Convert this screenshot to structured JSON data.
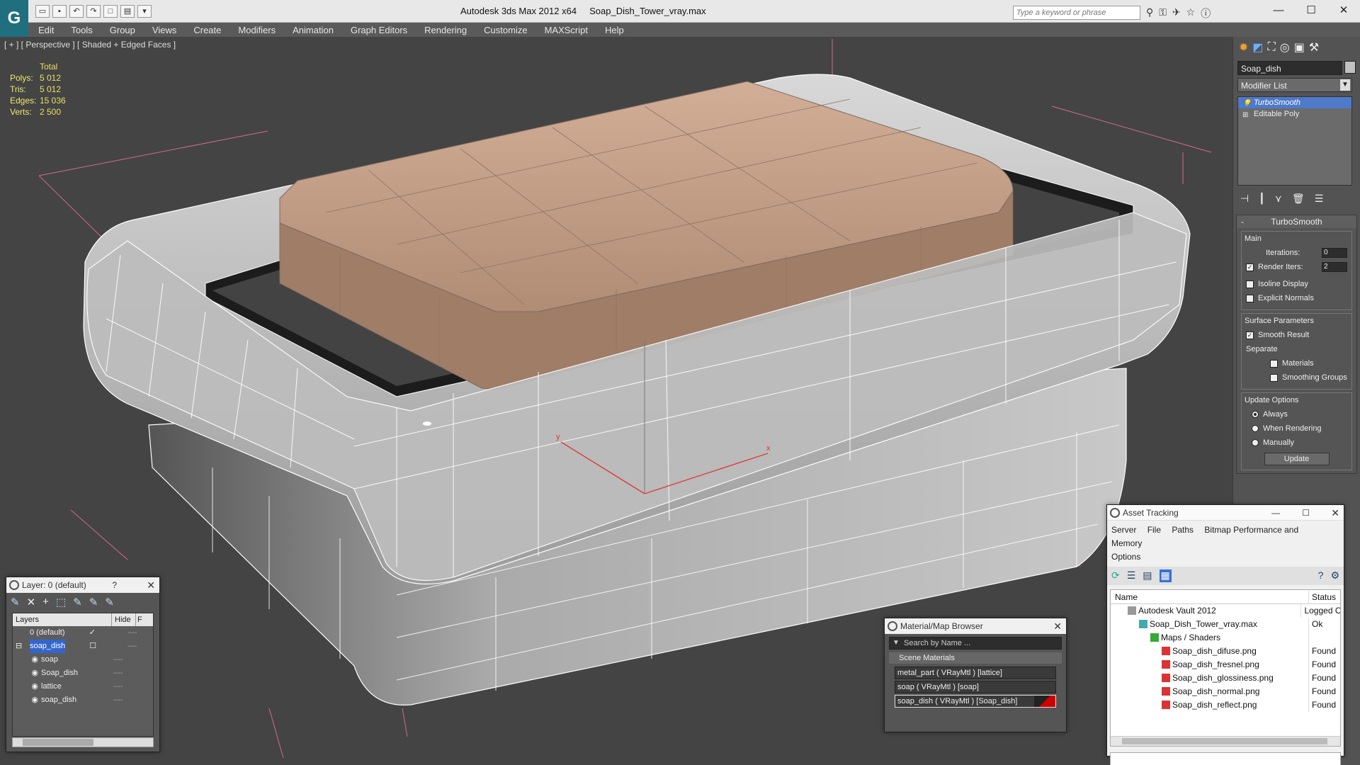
{
  "title_bar": {
    "app_title": "Autodesk 3ds Max  2012 x64",
    "file_title": "Soap_Dish_Tower_vray.max",
    "search_placeholder": "Type a keyword or phrase",
    "minimize": "—",
    "maximize": "☐",
    "close": "✕"
  },
  "menu": [
    "Edit",
    "Tools",
    "Group",
    "Views",
    "Create",
    "Modifiers",
    "Animation",
    "Graph Editors",
    "Rendering",
    "Customize",
    "MAXScript",
    "Help"
  ],
  "viewport": {
    "label": "[ + ] [ Perspective ] [ Shaded + Edged Faces ]",
    "stats": {
      "header": "Total",
      "rows": [
        {
          "label": "Polys:",
          "value": "5 012"
        },
        {
          "label": "Tris:",
          "value": "5 012"
        },
        {
          "label": "Edges:",
          "value": "15 036"
        },
        {
          "label": "Verts:",
          "value": "2 500"
        }
      ]
    },
    "axis_x": "x",
    "axis_y": "y"
  },
  "command_panel": {
    "object_name": "Soap_dish",
    "modifier_list_label": "Modifier List",
    "stack": [
      "TurboSmooth",
      "Editable Poly"
    ],
    "rollout_title": "TurboSmooth",
    "main_group": "Main",
    "iterations_label": "Iterations:",
    "iterations_value": "0",
    "render_iters_label": "Render Iters:",
    "render_iters_value": "2",
    "isoline_label": "Isoline Display",
    "explicit_normals_label": "Explicit Normals",
    "surface_group": "Surface Parameters",
    "smooth_result_label": "Smooth Result",
    "separate_label": "Separate",
    "materials_label": "Materials",
    "smoothing_groups_label": "Smoothing Groups",
    "update_group": "Update Options",
    "always_label": "Always",
    "when_rendering_label": "When Rendering",
    "manually_label": "Manually",
    "update_button": "Update"
  },
  "layer_dialog": {
    "title": "Layer: 0 (default)",
    "help": "?",
    "close": "✕",
    "col_layers": "Layers",
    "col_hide": "Hide",
    "col_f": "F",
    "rows": [
      {
        "name": "0 (default)",
        "indent": 1,
        "selected": false
      },
      {
        "name": "soap_dish",
        "indent": 1,
        "selected": true
      },
      {
        "name": "soap",
        "indent": 2,
        "selected": false
      },
      {
        "name": "Soap_dish",
        "indent": 2,
        "selected": false
      },
      {
        "name": "lattice",
        "indent": 2,
        "selected": false
      },
      {
        "name": "soap_dish",
        "indent": 2,
        "selected": false
      }
    ],
    "hide_marker": "----"
  },
  "material_browser": {
    "title": "Material/Map Browser",
    "close": "✕",
    "search_placeholder": "Search by Name ...",
    "group_label": "Scene Materials",
    "materials": [
      "metal_part  ( VRayMtl ) [lattice]",
      "soap  ( VRayMtl ) [soap]",
      "soap_dish  ( VRayMtl ) [Soap_dish]"
    ]
  },
  "asset_tracking": {
    "title": "Asset Tracking",
    "minimize": "—",
    "maximize": "☐",
    "close": "✕",
    "menu": [
      "Server",
      "File",
      "Paths",
      "Bitmap Performance and Memory",
      "Options"
    ],
    "col_name": "Name",
    "col_status": "Status",
    "rows": [
      {
        "name": "Autodesk Vault 2012",
        "status": "Logged O",
        "indent": 1
      },
      {
        "name": "Soap_Dish_Tower_vray.max",
        "status": "Ok",
        "indent": 2
      },
      {
        "name": "Maps / Shaders",
        "status": "",
        "indent": 3
      },
      {
        "name": "Soap_dish_difuse.png",
        "status": "Found",
        "indent": 4
      },
      {
        "name": "Soap_dish_fresnel.png",
        "status": "Found",
        "indent": 4
      },
      {
        "name": "Soap_dish_glossiness.png",
        "status": "Found",
        "indent": 4
      },
      {
        "name": "Soap_dish_normal.png",
        "status": "Found",
        "indent": 4
      },
      {
        "name": "Soap_dish_reflect.png",
        "status": "Found",
        "indent": 4
      }
    ]
  },
  "colors": {
    "viewport_bg": "#444444",
    "soap": "#c9a48c",
    "dish": "#c8c8c8",
    "selection": "#4f79c9",
    "stats_text": "#f0e870"
  }
}
